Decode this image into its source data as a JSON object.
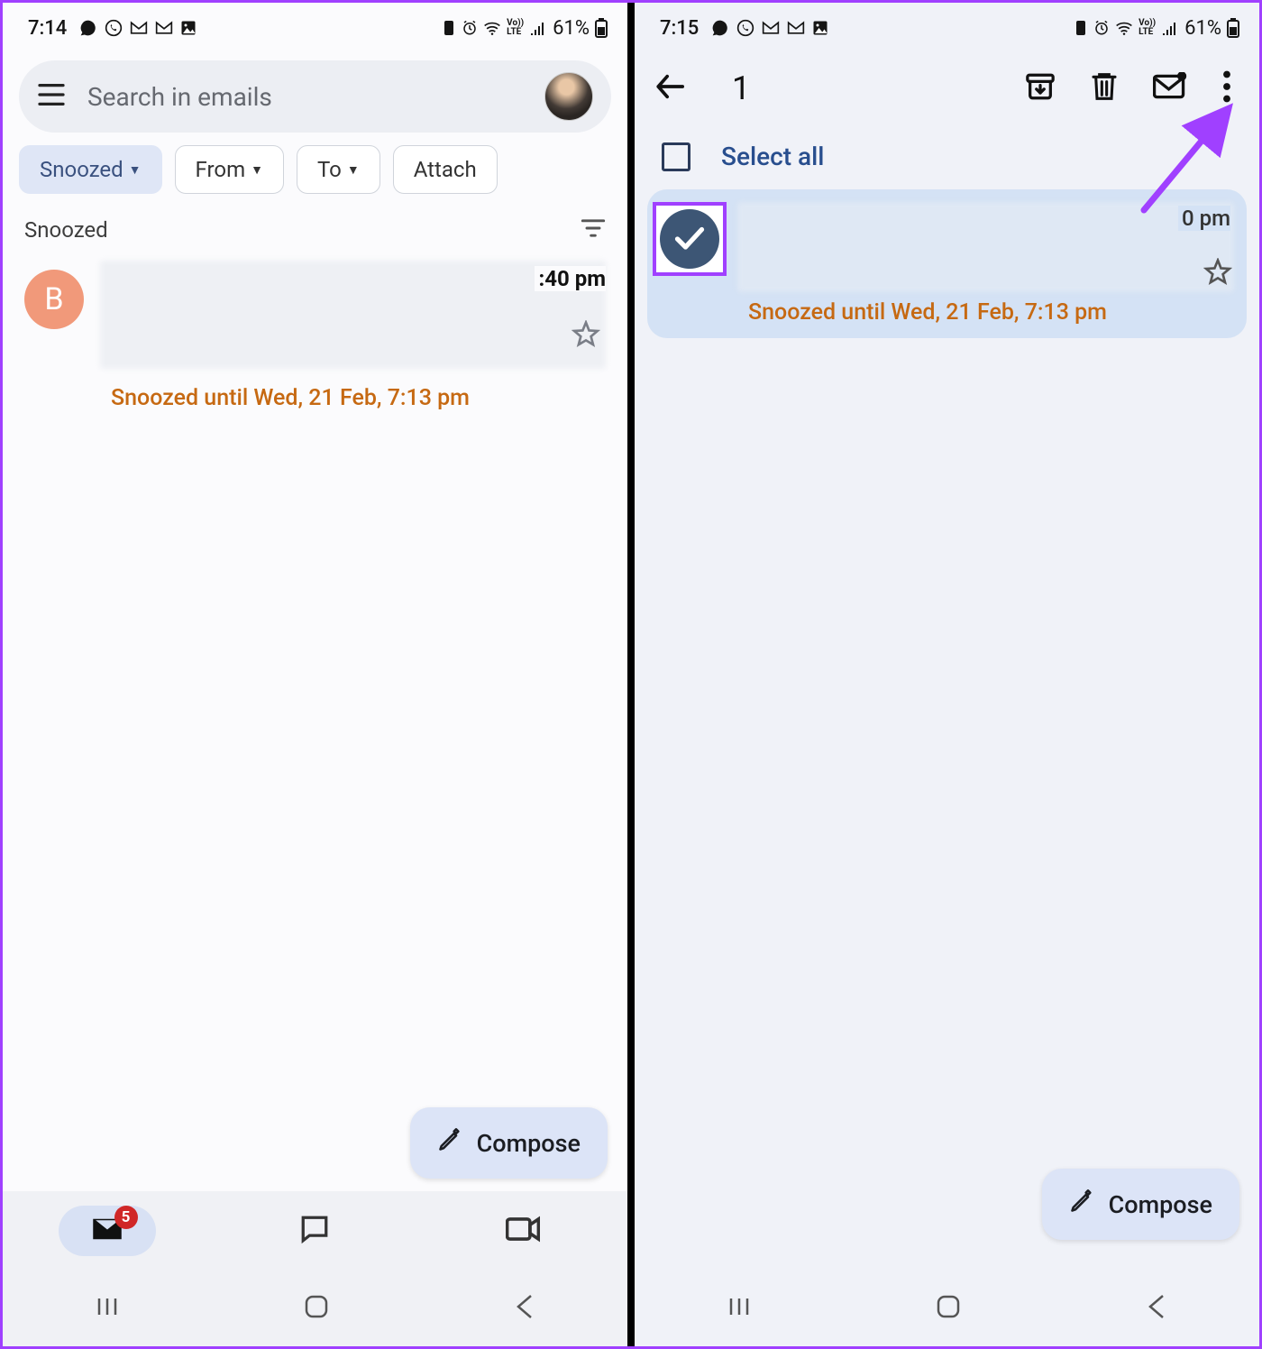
{
  "left": {
    "status": {
      "time": "7:14",
      "battery": "61%"
    },
    "search_placeholder": "Search in emails",
    "chips": {
      "snoozed": "Snoozed",
      "from": "From",
      "to": "To",
      "attach": "Attach"
    },
    "section_title": "Snoozed",
    "email": {
      "avatar_letter": "B",
      "time": ":40 pm",
      "snoozed_until": "Snoozed until Wed, 21 Feb, 7:13 pm"
    },
    "compose": "Compose",
    "badge_count": "5"
  },
  "right": {
    "status": {
      "time": "7:15",
      "battery": "61%"
    },
    "selection_count": "1",
    "select_all": "Select all",
    "email": {
      "time": "0 pm",
      "snoozed_until": "Snoozed until Wed, 21 Feb, 7:13 pm"
    },
    "compose": "Compose"
  }
}
